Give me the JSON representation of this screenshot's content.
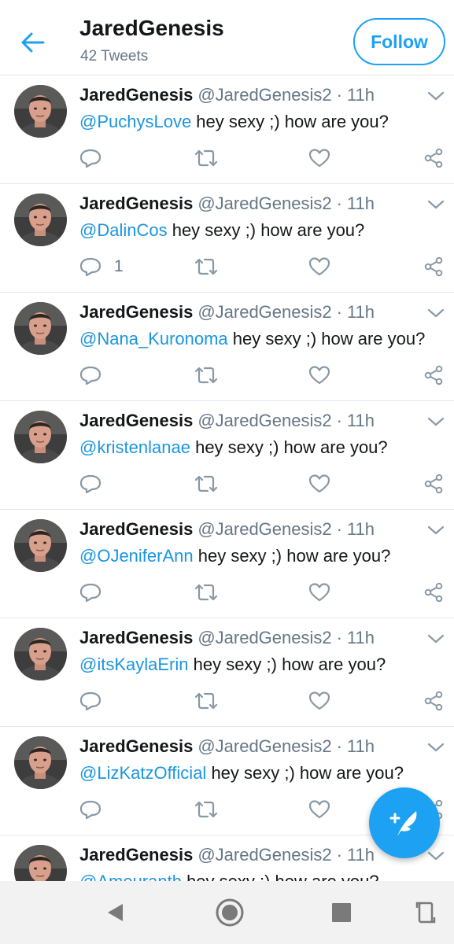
{
  "header": {
    "title": "JaredGenesis",
    "subtitle": "42 Tweets",
    "follow_label": "Follow"
  },
  "colors": {
    "accent": "#1da1f2",
    "mention": "#1b95e0",
    "secondary_text": "#657786",
    "divider": "#e1e8ed"
  },
  "tweets": [
    {
      "name": "JaredGenesis",
      "handle": "@JaredGenesis2",
      "dot": "·",
      "time": "11h",
      "mention": "@PuchysLove",
      "text": " hey sexy ;) how are you?",
      "reply_count": ""
    },
    {
      "name": "JaredGenesis",
      "handle": "@JaredGenesis2",
      "dot": "·",
      "time": "11h",
      "mention": "@DalinCos",
      "text": " hey sexy ;) how are you?",
      "reply_count": "1"
    },
    {
      "name": "JaredGenesis",
      "handle": "@JaredGenesis2",
      "dot": "·",
      "time": "11h",
      "mention": "@Nana_Kuronoma",
      "text": " hey sexy ;) how are you?",
      "reply_count": ""
    },
    {
      "name": "JaredGenesis",
      "handle": "@JaredGenesis2",
      "dot": "·",
      "time": "11h",
      "mention": "@kristenlanae",
      "text": " hey sexy ;) how are you?",
      "reply_count": ""
    },
    {
      "name": "JaredGenesis",
      "handle": "@JaredGenesis2",
      "dot": "·",
      "time": "11h",
      "mention": "@OJeniferAnn",
      "text": " hey sexy ;) how are you?",
      "reply_count": ""
    },
    {
      "name": "JaredGenesis",
      "handle": "@JaredGenesis2",
      "dot": "·",
      "time": "11h",
      "mention": "@itsKaylaErin",
      "text": " hey sexy ;) how are you?",
      "reply_count": ""
    },
    {
      "name": "JaredGenesis",
      "handle": "@JaredGenesis2",
      "dot": "·",
      "time": "11h",
      "mention": "@LizKatzOfficial",
      "text": " hey sexy ;) how are you?",
      "reply_count": ""
    },
    {
      "name": "JaredGenesis",
      "handle": "@JaredGenesis2",
      "dot": "·",
      "time": "11h",
      "mention": "@Amouranth",
      "text": " hey sexy ;) how are you?",
      "reply_count": ""
    }
  ],
  "icons": {
    "back": "arrow-left-icon",
    "caret": "chevron-down-icon",
    "reply": "reply-icon",
    "retweet": "retweet-icon",
    "like": "heart-icon",
    "share": "share-icon",
    "compose": "compose-tweet-icon",
    "nav_back": "triangle-back-icon",
    "nav_home": "circle-home-icon",
    "nav_recents": "square-recents-icon",
    "nav_rotate": "rotate-icon"
  }
}
